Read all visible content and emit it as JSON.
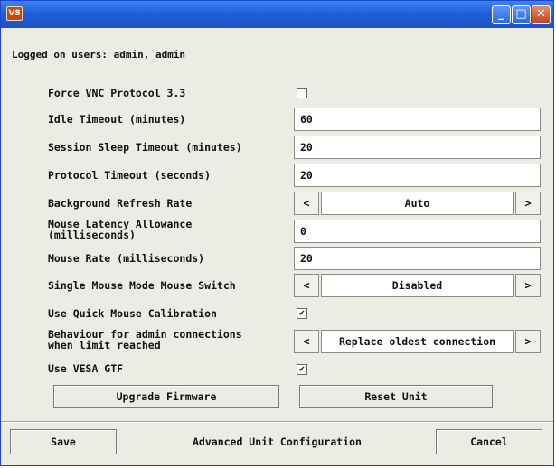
{
  "window": {
    "icon_text": "V8",
    "controls": {
      "minimize": "_",
      "maximize": "□",
      "close": "✕"
    }
  },
  "logged_on": "Logged on users: admin, admin",
  "settings": {
    "force_vnc": {
      "label": "Force VNC Protocol 3.3",
      "checked": false
    },
    "idle_timeout": {
      "label": "Idle Timeout (minutes)",
      "value": "60"
    },
    "session_sleep": {
      "label": "Session Sleep Timeout (minutes)",
      "value": "20"
    },
    "protocol_timeout": {
      "label": "Protocol Timeout (seconds)",
      "value": "20"
    },
    "bg_refresh": {
      "label": "Background Refresh Rate",
      "value": "Auto"
    },
    "mouse_latency": {
      "label_line1": "Mouse Latency Allowance",
      "label_line2": "(milliseconds)",
      "value": "0"
    },
    "mouse_rate": {
      "label": "Mouse Rate (milliseconds)",
      "value": "20"
    },
    "single_mouse": {
      "label": "Single Mouse Mode Mouse Switch",
      "value": "Disabled"
    },
    "quick_calibration": {
      "label": "Use Quick Mouse Calibration",
      "checked": true
    },
    "admin_behaviour": {
      "label_line1": "Behaviour for admin connections",
      "label_line2": "when limit reached",
      "value": "Replace oldest connection"
    },
    "vesa_gtf": {
      "label": "Use VESA GTF",
      "checked": true
    }
  },
  "arrows": {
    "left": "<",
    "right": ">"
  },
  "check_mark": "✔",
  "buttons": {
    "upgrade_firmware": "Upgrade Firmware",
    "reset_unit": "Reset Unit",
    "save": "Save",
    "cancel": "Cancel"
  },
  "status_text": "Advanced Unit Configuration"
}
